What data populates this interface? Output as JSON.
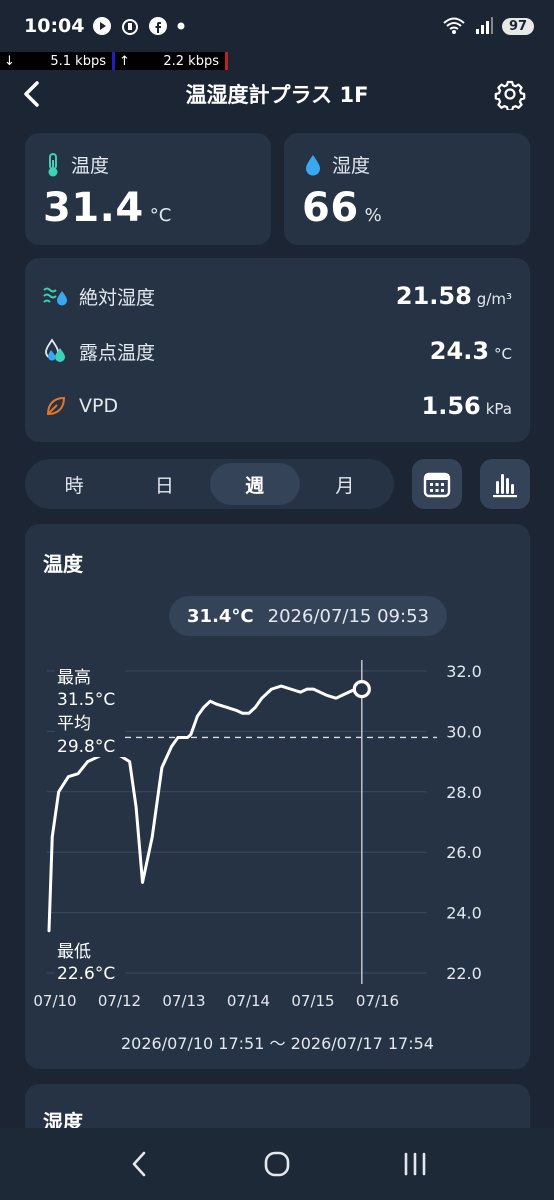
{
  "status_bar": {
    "time": "10:04",
    "battery": "97",
    "icons": [
      "play-icon",
      "alarm-icon",
      "facebook-icon",
      "dot-icon",
      "wifi-icon",
      "signal-icon",
      "battery-icon"
    ]
  },
  "net_speed": {
    "down_arrow": "↓",
    "down": "5.1 kbps",
    "up_arrow": "↑",
    "up": "2.2 kbps"
  },
  "header": {
    "title": "温湿度計プラス 1F",
    "back_icon": "chevron-left-icon",
    "settings_icon": "gear-icon"
  },
  "temperature": {
    "label": "温度",
    "value": "31.4",
    "unit": "°C",
    "icon": "thermometer-icon",
    "color": "#3fd1b5"
  },
  "humidity": {
    "label": "湿度",
    "value": "66",
    "unit": "%",
    "icon": "droplet-icon",
    "color": "#3aa8f0"
  },
  "details": [
    {
      "label": "絶対湿度",
      "value": "21.58",
      "unit": "g/m³",
      "icon": "absolute-humidity-icon"
    },
    {
      "label": "露点温度",
      "value": "24.3",
      "unit": "°C",
      "icon": "dew-point-icon"
    },
    {
      "label": "VPD",
      "value": "1.56",
      "unit": "kPa",
      "icon": "leaf-icon"
    }
  ],
  "period_tabs": [
    "時",
    "日",
    "週",
    "月"
  ],
  "active_tab": "週",
  "chart": {
    "title": "温度",
    "tooltip_value": "31.4°C",
    "tooltip_time": "2026/07/15 09:53",
    "max_label": "最高",
    "max_value": "31.5°C",
    "avg_label": "平均",
    "avg_value": "29.8°C",
    "min_label": "最低",
    "min_value": "22.6°C",
    "range": "2026/07/10 17:51 〜 2026/07/17 17:54"
  },
  "chart_data": {
    "type": "line",
    "title": "温度",
    "x_ticks": [
      "07/10",
      "07/12",
      "07/13",
      "07/14",
      "07/15",
      "07/16"
    ],
    "y_ticks": [
      "32.0",
      "30.0",
      "28.0",
      "26.0",
      "24.0",
      "22.0"
    ],
    "ylim": [
      22.0,
      32.0
    ],
    "average": 29.8,
    "series": [
      {
        "x": [
          0.0,
          0.05,
          0.15,
          0.3,
          0.45,
          0.6,
          0.8,
          1.0,
          1.1,
          1.25,
          1.35,
          1.45,
          1.6,
          1.75,
          1.9,
          2.0,
          2.05,
          2.1,
          2.15,
          2.2,
          2.25,
          2.3,
          2.4,
          2.5,
          2.6,
          2.75,
          2.9,
          3.0,
          3.1,
          3.2,
          3.3,
          3.45,
          3.6,
          3.75,
          3.9,
          4.0,
          4.1,
          4.2,
          4.3,
          4.45,
          4.55,
          4.65,
          4.75,
          4.85
        ],
        "y": [
          23.4,
          26.5,
          28.0,
          28.5,
          28.6,
          29.0,
          29.2,
          29.3,
          29.2,
          29.0,
          27.5,
          25.0,
          26.5,
          28.8,
          29.5,
          29.8,
          29.8,
          29.8,
          29.8,
          29.9,
          30.2,
          30.5,
          30.8,
          31.0,
          30.9,
          30.8,
          30.7,
          30.6,
          30.6,
          30.8,
          31.1,
          31.4,
          31.5,
          31.4,
          31.3,
          31.4,
          31.4,
          31.3,
          31.2,
          31.1,
          31.2,
          31.3,
          31.4,
          31.4
        ]
      }
    ],
    "grid": true
  },
  "colors": {
    "background": "#1b2533",
    "card": "#263345",
    "accent": "#344358",
    "vpd_leaf": "#e0742a"
  },
  "next_card_title": "湿度"
}
